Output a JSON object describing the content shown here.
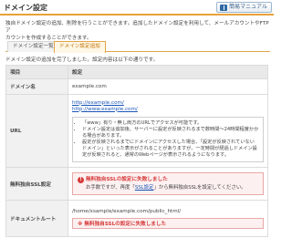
{
  "header": {
    "title": "ドメイン設定",
    "manual_label": "簡易マニュアル",
    "manual_icon": "book-icon"
  },
  "intro": {
    "line1": "独自ドメイン設定の追加、削除を行うことができます。追加したドメイン設定を利用して、メールアカウントやFTPア",
    "line2": "カウントを作成することができます。"
  },
  "tabs": [
    {
      "label": "ドメイン設定一覧",
      "active": false
    },
    {
      "label": "ドメイン設定追加",
      "active": true
    }
  ],
  "done_message": "ドメイン設定の追加を完了しました。設定内容は以下の通りです。",
  "table": {
    "head": {
      "item": "項目",
      "setting": "設定"
    },
    "domain": {
      "label": "ドメイン名",
      "value": "example.com"
    },
    "url": {
      "label": "URL",
      "links": [
        "http://example.com/",
        "http://www.example.com/"
      ],
      "notes": [
        "「www」有り・無し両方のURLでアクセスが可能です。",
        "ドメイン設定は追加後、サーバーに設定が反映されるまで数時間〜24時間程度かかる場合があります。",
        "設定が反映されるまでにドメインにアクセスした場合、「設定が反映されていないドメイン」といった表示がされることがありますが、一定時間が経過しドメイン設定が反映されると、通常のWebページが表示されるようになります。"
      ]
    },
    "ssl": {
      "label": "無料独自SSL設定",
      "title": "無料独自SSLの設定に失敗しました",
      "body_pre": "お手数ですが、再度「",
      "body_link": "SSL設定",
      "body_post": "」から無料独自SSLを設定してください。"
    },
    "docroot": {
      "label": "ドキュメントルート",
      "path": "/home/xsample/example.com/public_html/",
      "note": "※ 無料独自SSLの設定に失敗しました"
    }
  },
  "colors": {
    "accent": "#e8a23a",
    "link": "#1a56b8",
    "error": "#d63a3a"
  }
}
